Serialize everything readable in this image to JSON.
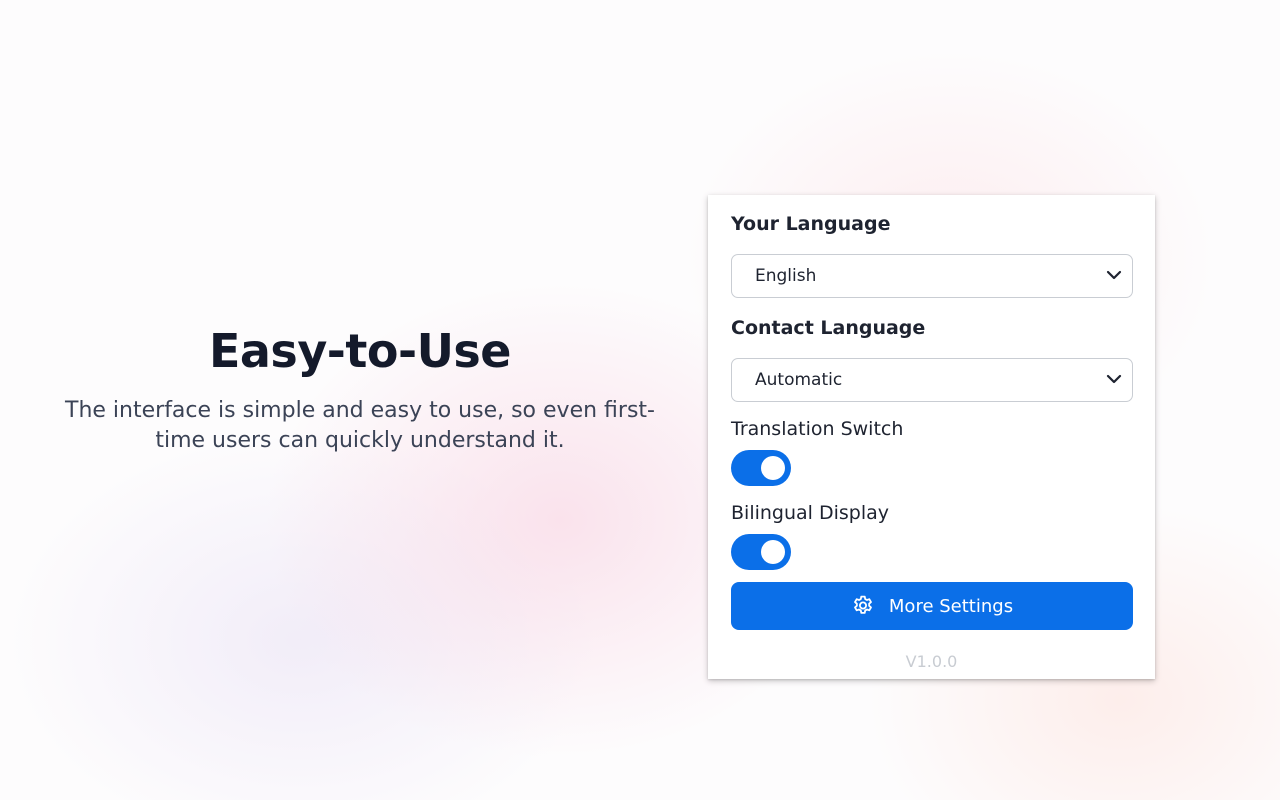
{
  "hero": {
    "title": "Easy-to-Use",
    "description": "The interface is simple and easy to use, so even first-time users can quickly understand it."
  },
  "panel": {
    "your_language": {
      "label": "Your Language",
      "selected": "English"
    },
    "contact_language": {
      "label": "Contact Language",
      "selected": "Automatic"
    },
    "translation_switch": {
      "label": "Translation Switch",
      "enabled": true
    },
    "bilingual_display": {
      "label": "Bilingual Display",
      "enabled": true
    },
    "more_settings": {
      "label": "More Settings",
      "icon": "gear-icon"
    },
    "version": "V1.0.0"
  },
  "colors": {
    "accent": "#0b6fe8",
    "title_text": "#141a2b",
    "body_text": "#3b4356",
    "version_text": "#c8ccd2"
  }
}
